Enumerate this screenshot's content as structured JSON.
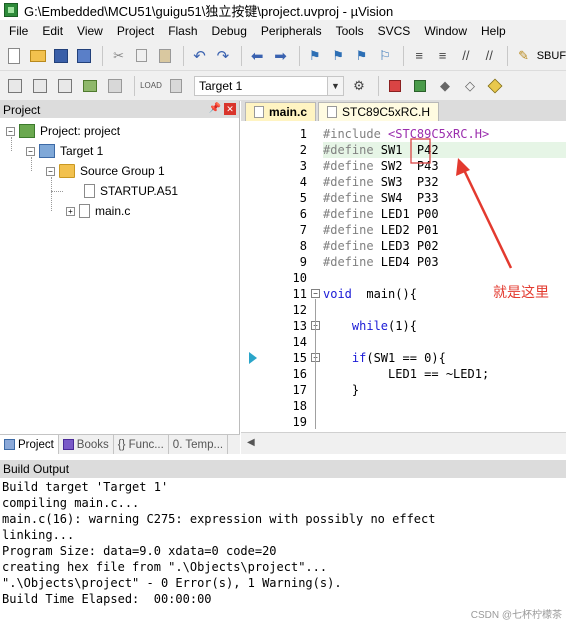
{
  "window": {
    "title": "G:\\Embedded\\MCU51\\guigu51\\独立按键\\project.uvproj - µVision"
  },
  "menu": [
    "File",
    "Edit",
    "View",
    "Project",
    "Flash",
    "Debug",
    "Peripherals",
    "Tools",
    "SVCS",
    "Window",
    "Help"
  ],
  "toolbar": {
    "sbuf_label": "SBUF",
    "target_value": "Target 1"
  },
  "project_panel": {
    "header": "Project",
    "tree": {
      "project": "Project: project",
      "target": "Target 1",
      "group": "Source Group 1",
      "files": [
        "STARTUP.A51",
        "main.c"
      ]
    },
    "tabs": [
      "Project",
      "Books",
      "{} Func...",
      "0. Temp..."
    ]
  },
  "editor": {
    "tabs": [
      "main.c",
      "STC89C5xRC.H"
    ],
    "line_numbers": [
      "1",
      "2",
      "3",
      "4",
      "5",
      "6",
      "7",
      "8",
      "9",
      "10",
      "11",
      "12",
      "13",
      "14",
      "15",
      "16",
      "17",
      "18",
      "19"
    ],
    "lines": [
      {
        "pp": "#include",
        "rest": " ",
        "str": "<STC89C5xRC.H>"
      },
      {
        "pp": "#define",
        "rest": " SW1  P42"
      },
      {
        "pp": "#define",
        "rest": " SW2  P43"
      },
      {
        "pp": "#define",
        "rest": " SW3  P32"
      },
      {
        "pp": "#define",
        "rest": " SW4  P33"
      },
      {
        "pp": "#define",
        "rest": " LED1 P00"
      },
      {
        "pp": "#define",
        "rest": " LED2 P01"
      },
      {
        "pp": "#define",
        "rest": " LED3 P02"
      },
      {
        "pp": "#define",
        "rest": " LED4 P03"
      },
      {
        "text": ""
      },
      {
        "kw": "void",
        "rest": "  main(){"
      },
      {
        "text": ""
      },
      {
        "indent": "    ",
        "kw": "while",
        "rest": "(1){"
      },
      {
        "text": ""
      },
      {
        "indent": "    ",
        "kw": "if",
        "rest": "(SW1 == 0){"
      },
      {
        "text": "         LED1 == ~LED1;"
      },
      {
        "text": "    }"
      },
      {
        "text": ""
      },
      {
        "text": ""
      }
    ]
  },
  "annotation": "就是这里",
  "build_output": {
    "header": "Build Output",
    "lines": [
      "Build target 'Target 1'",
      "compiling main.c...",
      "main.c(16): warning C275: expression with possibly no effect",
      "linking...",
      "Program Size: data=9.0 xdata=0 code=20",
      "creating hex file from \".\\Objects\\project\"...",
      "\".\\Objects\\project\" - 0 Error(s), 1 Warning(s).",
      "Build Time Elapsed:  00:00:00"
    ]
  },
  "watermark": "CSDN @七杯柠檬茶",
  "colors": {
    "accent_red": "#e33a2f",
    "highlight_green": "#e6f5e6",
    "keyword_blue": "#1a1ad6"
  }
}
